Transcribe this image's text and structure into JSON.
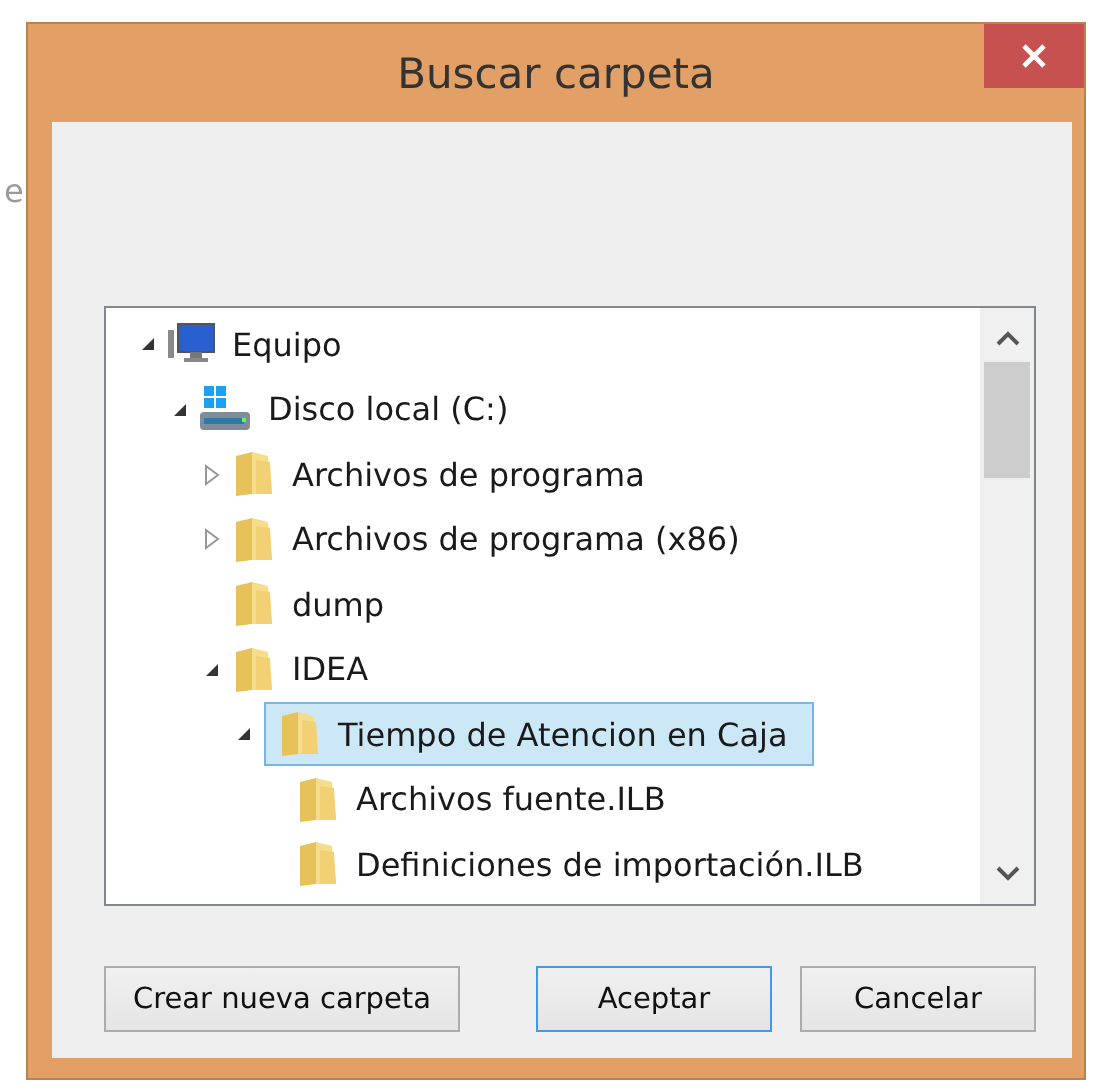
{
  "background_text": "e",
  "window": {
    "title": "Buscar carpeta"
  },
  "tree": [
    {
      "label": "Equipo",
      "kind": "computer",
      "expanded": true,
      "selected": false,
      "children": [
        {
          "label": "Disco local (C:)",
          "kind": "drive",
          "expanded": true,
          "selected": false,
          "children": [
            {
              "label": "Archivos de programa",
              "kind": "folder",
              "expanded": false,
              "selected": false
            },
            {
              "label": "Archivos de programa (x86)",
              "kind": "folder",
              "expanded": false,
              "selected": false
            },
            {
              "label": "dump",
              "kind": "folder",
              "selected": false
            },
            {
              "label": "IDEA",
              "kind": "folder",
              "expanded": true,
              "selected": false,
              "children": [
                {
                  "label": "Tiempo de Atencion en Caja",
                  "kind": "folder",
                  "expanded": true,
                  "selected": true,
                  "children": [
                    {
                      "label": "Archivos fuente.ILB",
                      "kind": "folder",
                      "selected": false
                    },
                    {
                      "label": "Definiciones de importación.ILB",
                      "kind": "folder",
                      "selected": false
                    }
                  ]
                }
              ]
            }
          ]
        }
      ]
    }
  ],
  "buttons": [
    {
      "label": "Crear nueva carpeta",
      "default": false
    },
    {
      "label": "Aceptar",
      "default": true
    },
    {
      "label": "Cancelar",
      "default": false
    }
  ]
}
